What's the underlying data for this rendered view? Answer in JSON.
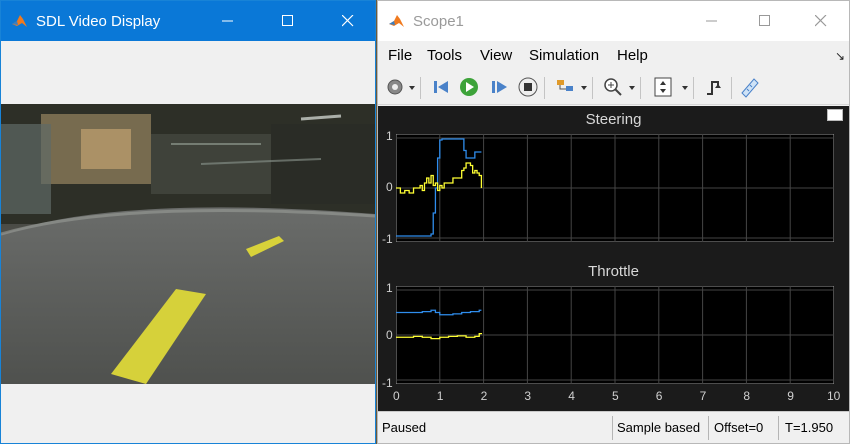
{
  "sdl_window": {
    "title": "SDL Video Display"
  },
  "scope_window": {
    "title": "Scope1"
  },
  "menu": [
    "File",
    "Tools",
    "View",
    "Simulation",
    "Help"
  ],
  "toolbar": {
    "icons": [
      "gear-icon",
      "step-back-icon",
      "run-icon",
      "step-forward-icon",
      "stop-icon",
      "highlight-icon",
      "zoom-in-icon",
      "scale-axes-icon",
      "triggers-icon",
      "measurements-icon"
    ]
  },
  "status": {
    "state": "Paused",
    "mode": "Sample based",
    "offset": "Offset=0",
    "time": "T=1.950"
  },
  "colors": {
    "series1": "#2f8ded",
    "series2": "#ffff33",
    "background": "#000000",
    "grid": "#454545"
  },
  "chart_data": [
    {
      "type": "line",
      "title": "Steering",
      "xlim": [
        0,
        10
      ],
      "ylim": [
        -1,
        1
      ],
      "xticks": [
        "0",
        "1",
        "2",
        "3",
        "4",
        "5",
        "6",
        "7",
        "8",
        "9",
        "10"
      ],
      "yticks": [
        "1",
        "0",
        "-1"
      ],
      "series": [
        {
          "color": "#2f8ded",
          "x": [
            0,
            0.35,
            0.55,
            0.8,
            0.85,
            0.9,
            0.95,
            1.0,
            1.05,
            1.1,
            1.5,
            1.55,
            1.6,
            1.75,
            1.8,
            1.95
          ],
          "y": [
            -0.96,
            -0.96,
            -0.96,
            -0.92,
            -0.5,
            0.0,
            0.6,
            0.96,
            0.98,
            0.98,
            0.98,
            0.75,
            0.6,
            0.6,
            0.72,
            0.72
          ]
        },
        {
          "color": "#ffff33",
          "x": [
            0,
            0.1,
            0.2,
            0.3,
            0.4,
            0.5,
            0.55,
            0.6,
            0.65,
            0.7,
            0.75,
            0.8,
            0.85,
            0.9,
            0.95,
            1.0,
            1.05,
            1.1,
            1.2,
            1.3,
            1.4,
            1.5,
            1.55,
            1.6,
            1.7,
            1.75,
            1.8,
            1.85,
            1.9,
            1.95
          ],
          "y": [
            0.0,
            -0.1,
            -0.05,
            -0.1,
            0.0,
            0.0,
            0.05,
            -0.05,
            0.1,
            0.2,
            0.1,
            0.25,
            0.05,
            0.1,
            -0.05,
            0.05,
            0.0,
            0.1,
            0.1,
            0.2,
            0.2,
            0.35,
            0.4,
            0.5,
            0.45,
            0.3,
            0.35,
            0.3,
            0.25,
            0.0
          ]
        }
      ]
    },
    {
      "type": "line",
      "title": "Throttle",
      "xlim": [
        0,
        10
      ],
      "ylim": [
        -1,
        1
      ],
      "xticks": [
        "0",
        "1",
        "2",
        "3",
        "4",
        "5",
        "6",
        "7",
        "8",
        "9",
        "10"
      ],
      "yticks": [
        "1",
        "0",
        "-1"
      ],
      "series": [
        {
          "color": "#2f8ded",
          "x": [
            0,
            0.4,
            0.6,
            0.8,
            0.9,
            1.0,
            1.1,
            1.3,
            1.5,
            1.7,
            1.9,
            1.95
          ],
          "y": [
            0.5,
            0.5,
            0.52,
            0.55,
            0.5,
            0.45,
            0.45,
            0.47,
            0.5,
            0.52,
            0.55,
            0.55
          ]
        },
        {
          "color": "#ffff33",
          "x": [
            0,
            0.2,
            0.4,
            0.6,
            0.8,
            1.0,
            1.2,
            1.4,
            1.6,
            1.8,
            1.9,
            1.95
          ],
          "y": [
            -0.05,
            -0.05,
            -0.03,
            -0.05,
            -0.08,
            -0.05,
            -0.03,
            -0.02,
            -0.05,
            -0.03,
            0.03,
            0.02
          ]
        }
      ]
    }
  ]
}
